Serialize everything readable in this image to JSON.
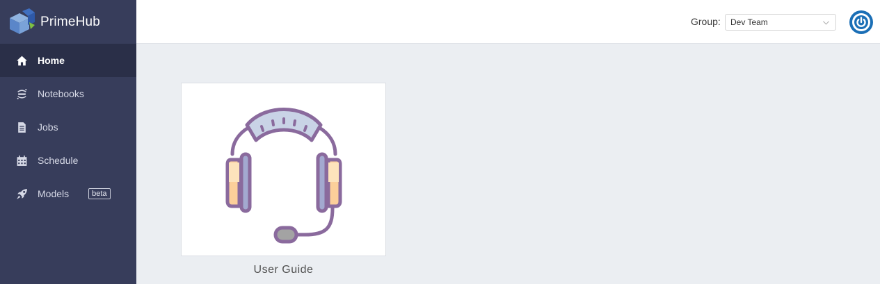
{
  "app": {
    "name": "PrimeHub",
    "brand_colors": {
      "sidebar": "#373d5b",
      "sidebar_active": "#2a2f48",
      "accent": "#1b6fb6"
    }
  },
  "sidebar": {
    "items": [
      {
        "label": "Home",
        "icon": "home-icon",
        "active": true
      },
      {
        "label": "Notebooks",
        "icon": "jupyter-icon",
        "active": false
      },
      {
        "label": "Jobs",
        "icon": "document-list-icon",
        "active": false
      },
      {
        "label": "Schedule",
        "icon": "calendar-icon",
        "active": false
      },
      {
        "label": "Models",
        "icon": "rocket-icon",
        "active": false,
        "badge": "beta"
      }
    ]
  },
  "header": {
    "group_label": "Group:",
    "group_select": {
      "value": "Dev Team"
    },
    "power_icon": "power-icon"
  },
  "main": {
    "cards": [
      {
        "caption": "User Guide",
        "icon": "headset-icon"
      }
    ]
  }
}
